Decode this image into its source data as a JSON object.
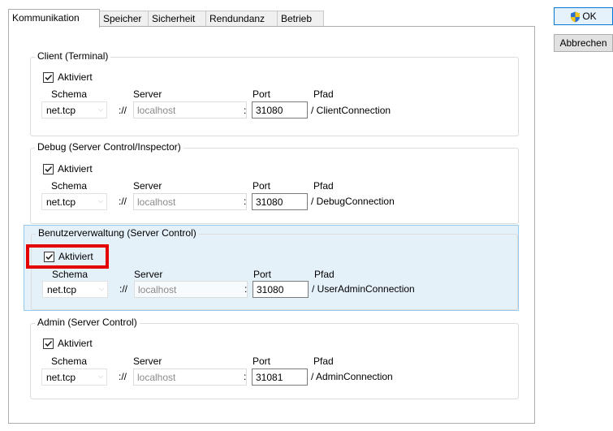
{
  "tabs": [
    "Kommunikation",
    "Speicher",
    "Sicherheit",
    "Rendundanz",
    "Betrieb"
  ],
  "buttons": {
    "ok": "OK",
    "cancel": "Abbrechen"
  },
  "field_labels": {
    "schema": "Schema",
    "server": "Server",
    "port": "Port",
    "path": "Pfad"
  },
  "groups": [
    {
      "title": "Client (Terminal)",
      "enabled_label": "Aktiviert",
      "checked": true,
      "schema": "net.tcp",
      "scheme_sep": "://",
      "server": "localhost",
      "port_sep": ":",
      "port": "31080",
      "path": "/ ClientConnection"
    },
    {
      "title": "Debug (Server Control/Inspector)",
      "enabled_label": "Aktiviert",
      "checked": true,
      "schema": "net.tcp",
      "scheme_sep": "://",
      "server": "localhost",
      "port_sep": ":",
      "port": "31080",
      "path": "/ DebugConnection"
    },
    {
      "title": "Benutzerverwaltung (Server Control)",
      "enabled_label": "Aktiviert",
      "checked": true,
      "schema": "net.tcp",
      "scheme_sep": "://",
      "server": "localhost",
      "port_sep": ":",
      "port": "31080",
      "path": "/ UserAdminConnection"
    },
    {
      "title": "Admin (Server Control)",
      "enabled_label": "Aktiviert",
      "checked": true,
      "schema": "net.tcp",
      "scheme_sep": "://",
      "server": "localhost",
      "port_sep": ":",
      "port": "31081",
      "path": "/ AdminConnection"
    }
  ],
  "colors": {
    "selection_bg": "#e5f1f9",
    "selection_border": "#99c9ef",
    "highlight": "#e50000",
    "primary_border": "#0078d7"
  }
}
